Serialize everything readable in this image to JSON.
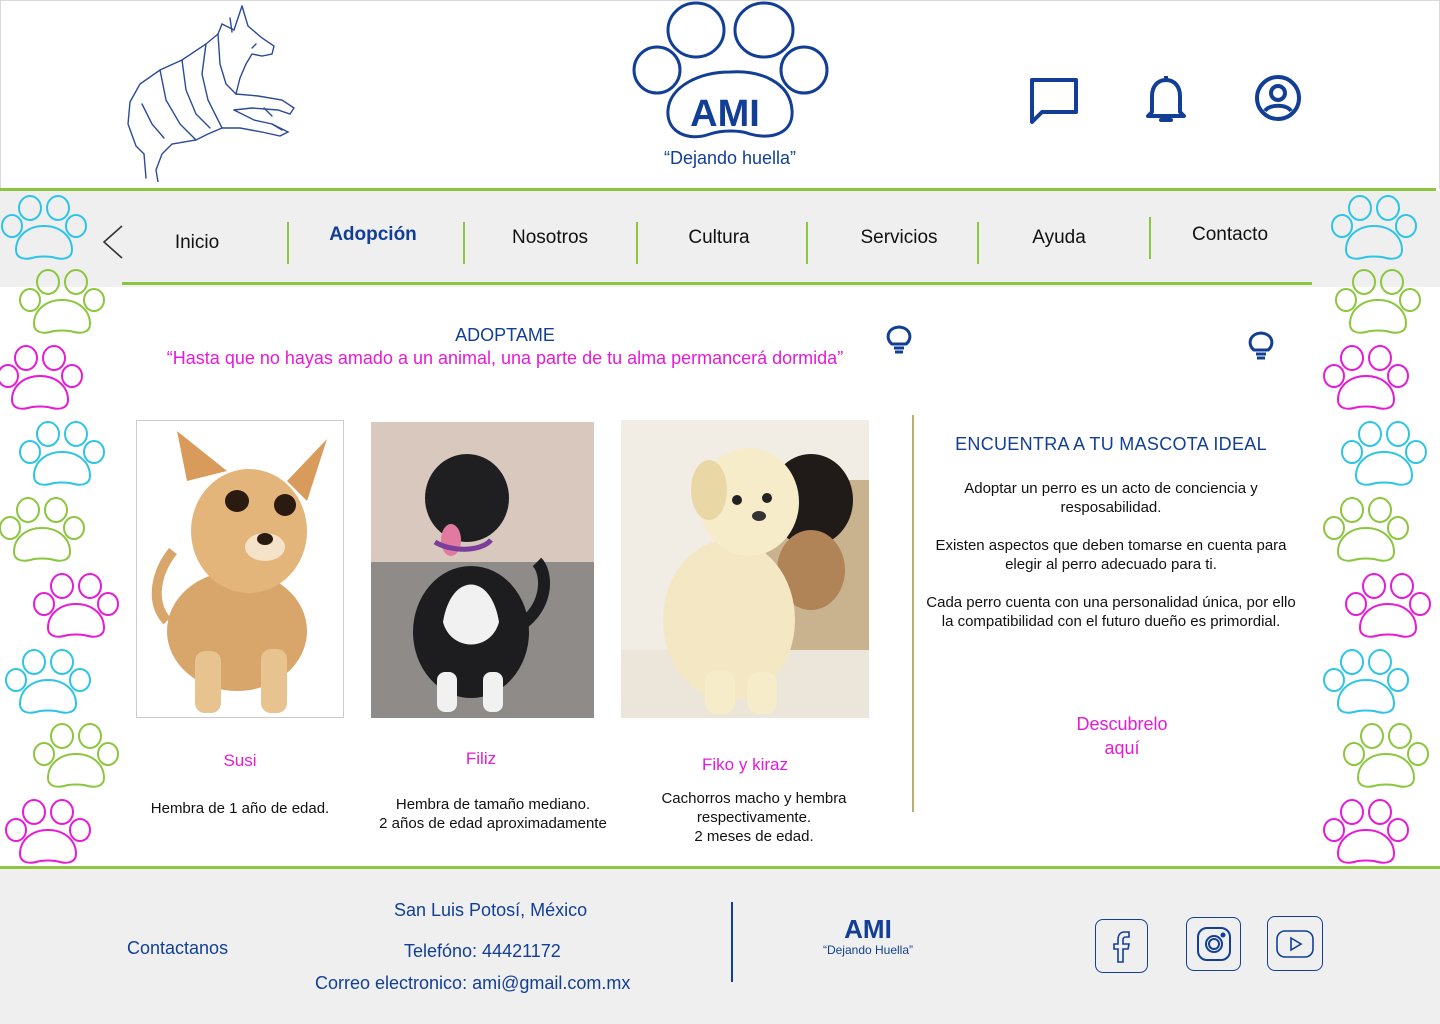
{
  "brand": {
    "name": "AMI",
    "tagline": "“Dejando huella”"
  },
  "header": {
    "icons": [
      "chat-icon",
      "bell-icon",
      "user-circle-icon"
    ]
  },
  "nav": {
    "items": [
      {
        "label": "Inicio"
      },
      {
        "label": "Adopción",
        "active": true
      },
      {
        "label": "Nosotros"
      },
      {
        "label": "Cultura"
      },
      {
        "label": "Servicios"
      },
      {
        "label": "Ayuda"
      },
      {
        "label": "Contacto"
      }
    ]
  },
  "main": {
    "title": "ADOPTAME",
    "quote": "“Hasta que no hayas amado a un animal, una parte de tu alma permancerá dormida”",
    "pets": [
      {
        "name": "Susi",
        "description": "Hembra de 1 año de edad."
      },
      {
        "name": "Filiz",
        "description": "Hembra  de tamaño mediano.\n2 años de edad aproximadamente"
      },
      {
        "name": "Fiko y kiraz",
        "description": "Cachorros macho y hembra\nrespectivamente.\n2 meses de edad."
      }
    ]
  },
  "sidebar": {
    "title": "ENCUENTRA A TU MASCOTA IDEAL",
    "paragraphs": [
      "Adoptar un perro es un acto de conciencia y resposabilidad.",
      "Existen aspectos que deben tomarse en cuenta para elegir al perro adecuado para ti.",
      "Cada perro cuenta con una personalidad única, por ello la compatibilidad con el futuro dueño es primordial."
    ],
    "cta": "Descubrelo aquí"
  },
  "footer": {
    "contact_label": "Contactanos",
    "location": "San Luis Potosí, México",
    "phone": "Telefóno: 44421172",
    "email": "Correo electronico: ami@gmail.com.mx",
    "brand_name": "AMI",
    "brand_tagline": "“Dejando Huella”",
    "social": [
      "facebook-icon",
      "instagram-icon",
      "youtube-icon"
    ]
  },
  "colors": {
    "primary": "#123f95",
    "accent_green": "#8cc63f",
    "accent_pink": "#e51bd6",
    "accent_cyan": "#2ec4e6"
  }
}
